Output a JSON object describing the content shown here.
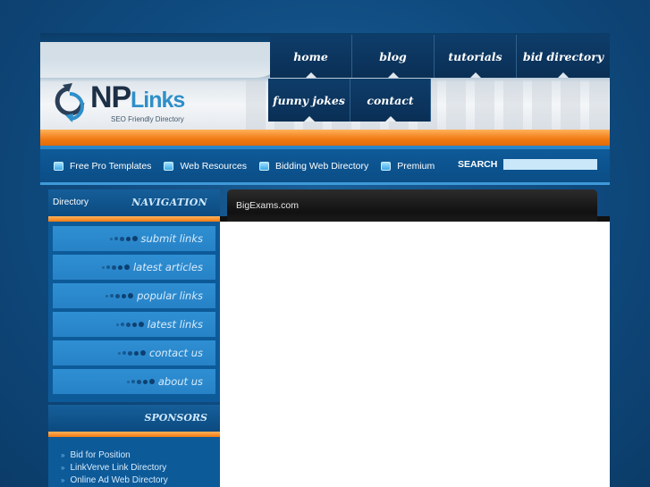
{
  "logo": {
    "np": "NP",
    "links": "Links",
    "tagline": "SEO Friendly Directory"
  },
  "main_nav": [
    {
      "label": "home"
    },
    {
      "label": "blog"
    },
    {
      "label": "tutorials"
    },
    {
      "label": "bid directory"
    },
    {
      "label": "funny jokes"
    },
    {
      "label": "contact"
    }
  ],
  "sub_nav": [
    {
      "label": "Free Pro Templates"
    },
    {
      "label": "Web Resources"
    },
    {
      "label": "Bidding Web Directory"
    },
    {
      "label": "Premium"
    }
  ],
  "search": {
    "label": "SEARCH",
    "value": ""
  },
  "sidebar": {
    "small_label": "Directory",
    "title": "NAVIGATION",
    "items": [
      {
        "label": "submit links"
      },
      {
        "label": "latest articles"
      },
      {
        "label": "popular links"
      },
      {
        "label": "latest links"
      },
      {
        "label": "contact us"
      },
      {
        "label": "about us"
      }
    ]
  },
  "sponsors": {
    "title": "SPONSORS",
    "links": [
      {
        "label": "Bid for Position"
      },
      {
        "label": "LinkVerve Link Directory"
      },
      {
        "label": "Online Ad Web Directory"
      }
    ]
  },
  "main": {
    "title": "BigExams.com"
  },
  "colors": {
    "accent_orange": "#f07a12",
    "nav_dark": "#0a2f55",
    "sidebar_blue": "#0d5a99",
    "item_blue": "#2f8fd3"
  },
  "icons": {
    "subnav_bullet": "square-bullet-icon",
    "sidebar_bullet": "dots-icon",
    "sponsor_bullet": "double-arrow-icon"
  }
}
